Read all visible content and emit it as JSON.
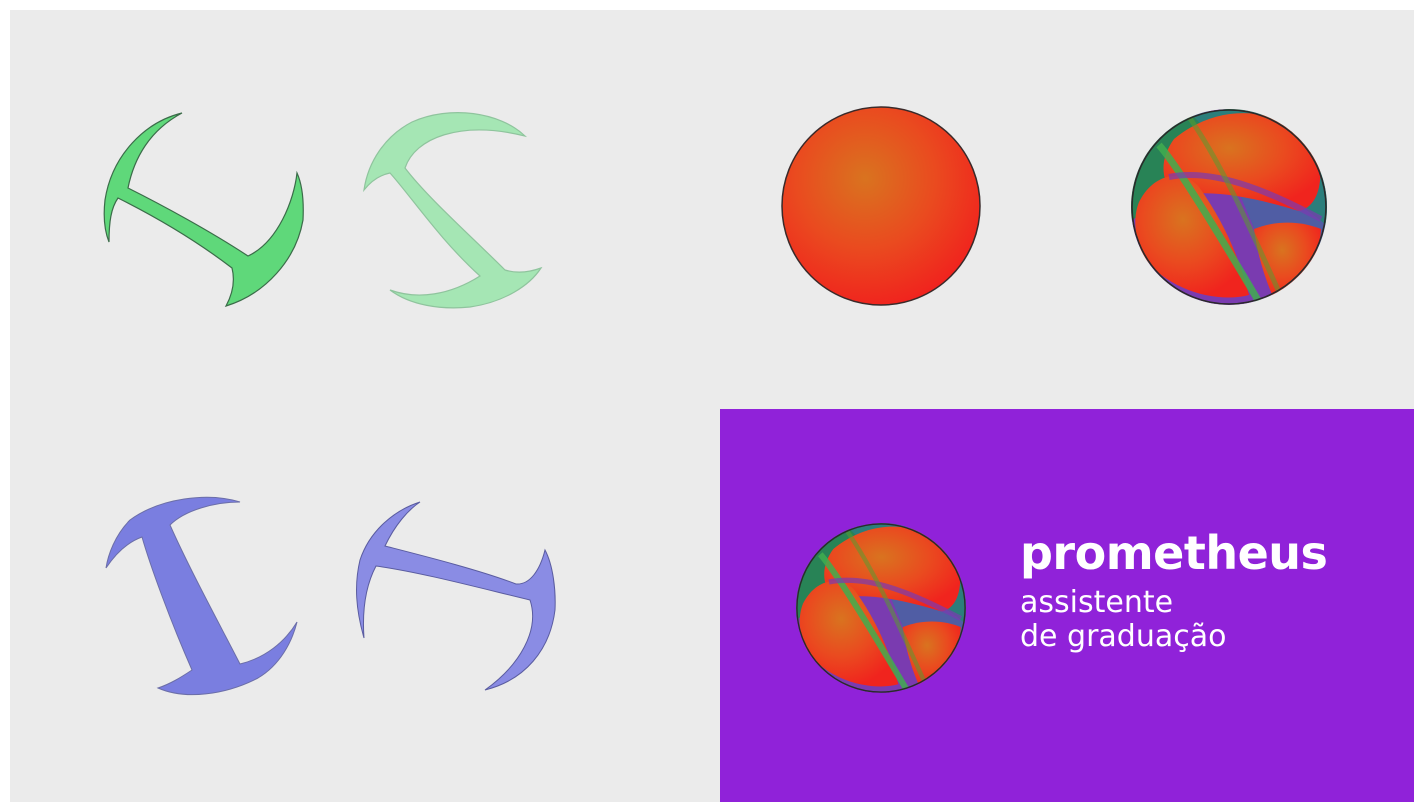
{
  "brand": {
    "name": "prometheus",
    "tagline_line1": "assistente",
    "tagline_line2": "de graduação"
  },
  "colors": {
    "background": "#ebebeb",
    "panel": "#9022d9",
    "green_dark": "#5fd87a",
    "green_light": "#a5e6b4",
    "blue_dark": "#7a7ee0",
    "blue_light": "#8a8ce4",
    "sphere_core": "#d9731f",
    "sphere_edge": "#f0281e",
    "wordmark_text": "#ffffff"
  },
  "icons": [
    "green-swoosh-icon",
    "light-green-swoosh-icon",
    "red-sphere-icon",
    "layered-sphere-icon",
    "blue-swoosh-icon",
    "blue-swoosh-alt-icon",
    "prometheus-logo-icon"
  ]
}
